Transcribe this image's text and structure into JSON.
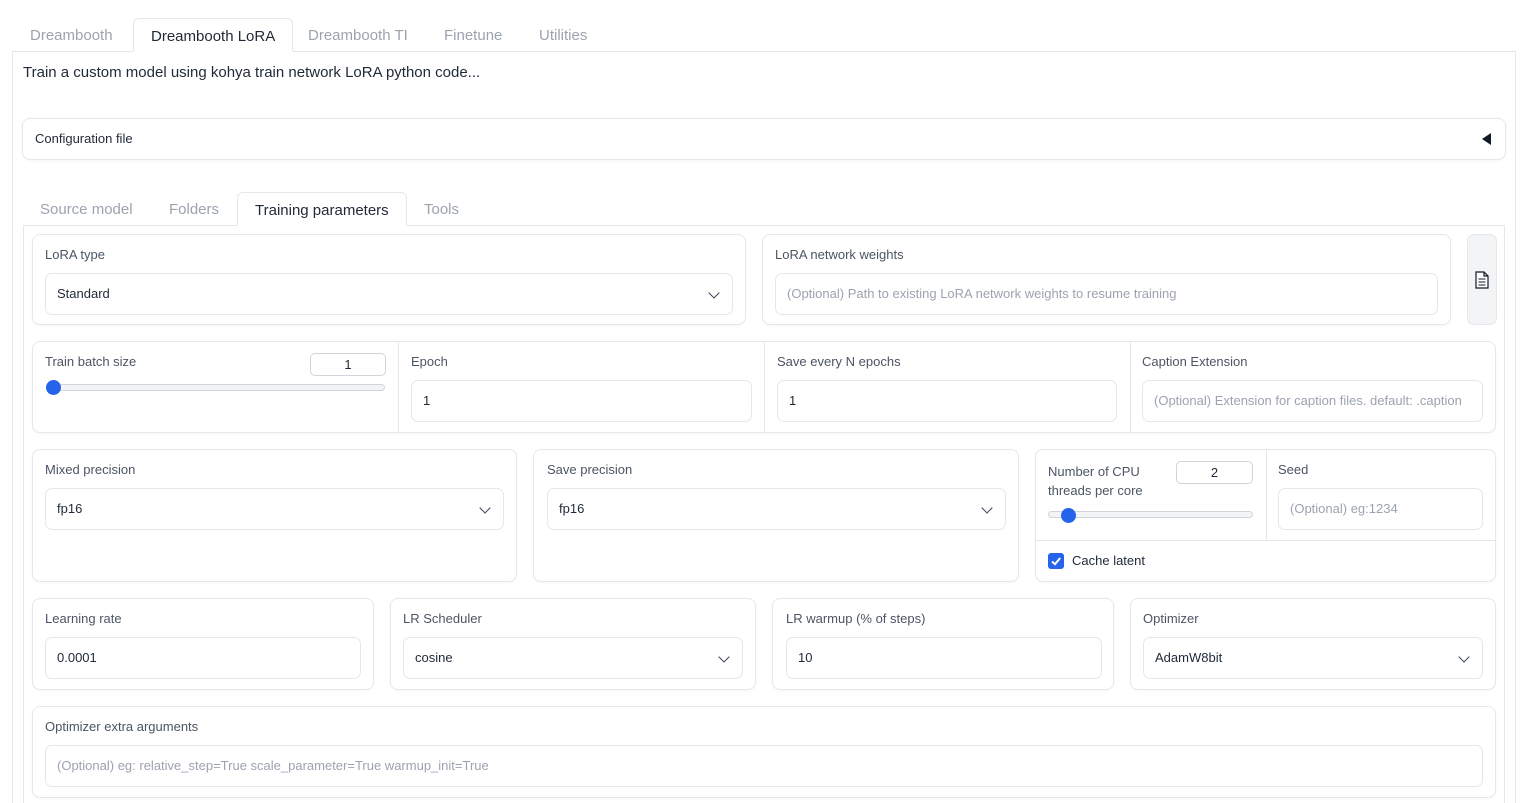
{
  "tabs": [
    "Dreambooth",
    "Dreambooth LoRA",
    "Dreambooth TI",
    "Finetune",
    "Utilities"
  ],
  "active_tab": "Dreambooth LoRA",
  "description": "Train a custom model using kohya train network LoRA python code...",
  "config_accordion": {
    "label": "Configuration file"
  },
  "subtabs": [
    "Source model",
    "Folders",
    "Training parameters",
    "Tools"
  ],
  "active_subtab": "Training parameters",
  "lora_type": {
    "label": "LoRA type",
    "value": "Standard"
  },
  "lora_network_weights": {
    "label": "LoRA network weights",
    "placeholder": "(Optional) Path to existing LoRA network weights to resume training",
    "icon": "file-icon"
  },
  "train_batch_size": {
    "label": "Train batch size",
    "value": "1",
    "fraction": 0.0
  },
  "epoch": {
    "label": "Epoch",
    "value": "1"
  },
  "save_every_n_epochs": {
    "label": "Save every N epochs",
    "value": "1"
  },
  "caption_extension": {
    "label": "Caption Extension",
    "placeholder": "(Optional) Extension for caption files. default: .caption"
  },
  "mixed_precision": {
    "label": "Mixed precision",
    "value": "fp16"
  },
  "save_precision": {
    "label": "Save precision",
    "value": "fp16"
  },
  "cpu_threads": {
    "label_line1": "Number of CPU",
    "label_line2": "threads per core",
    "value": "2",
    "fraction": 0.07
  },
  "seed": {
    "label": "Seed",
    "placeholder": "(Optional) eg:1234"
  },
  "cache_latent": {
    "label": "Cache latent",
    "checked": true
  },
  "learning_rate": {
    "label": "Learning rate",
    "value": "0.0001"
  },
  "lr_scheduler": {
    "label": "LR Scheduler",
    "value": "cosine"
  },
  "lr_warmup": {
    "label": "LR warmup (% of steps)",
    "value": "10"
  },
  "optimizer": {
    "label": "Optimizer",
    "value": "AdamW8bit"
  },
  "optimizer_extra_args": {
    "label": "Optimizer extra arguments",
    "placeholder": "(Optional) eg: relative_step=True scale_parameter=True warmup_init=True"
  },
  "colors": {
    "accent": "#2563eb",
    "border": "#e5e7eb",
    "muted": "#9ca3af"
  }
}
